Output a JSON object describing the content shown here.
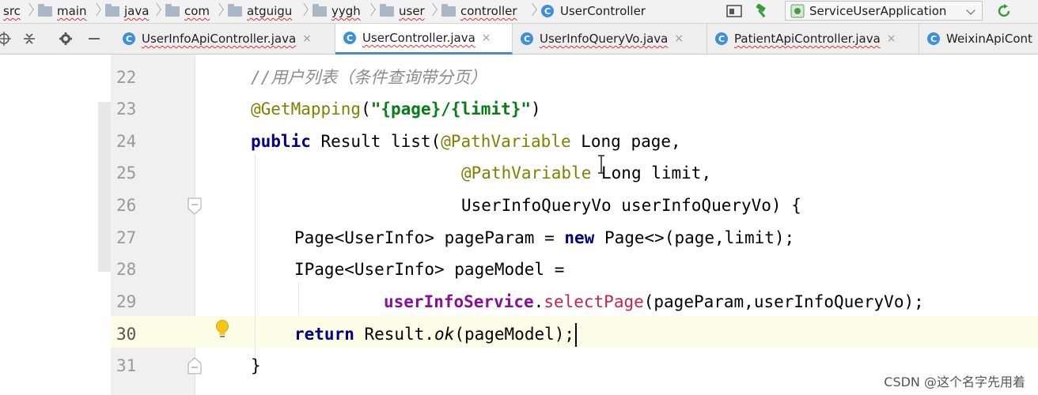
{
  "breadcrumb": {
    "items": [
      {
        "label": "src",
        "icon": "none"
      },
      {
        "label": "main",
        "icon": "folder-icon"
      },
      {
        "label": "java",
        "icon": "folder-icon"
      },
      {
        "label": "com",
        "icon": "folder-icon"
      },
      {
        "label": "atguigu",
        "icon": "folder-icon"
      },
      {
        "label": "yygh",
        "icon": "folder-icon"
      },
      {
        "label": "user",
        "icon": "folder-icon"
      },
      {
        "label": "controller",
        "icon": "folder-icon"
      },
      {
        "label": "UserController",
        "icon": "class-icon"
      }
    ]
  },
  "toolbar": {
    "run_config_label": "ServiceUserApplication",
    "icons": [
      "layout-icon",
      "build-hammer-icon",
      "run-config-app-icon",
      "reload-icon"
    ]
  },
  "tabs": [
    {
      "label": "UserInfoApiController.java",
      "icon": "class-icon",
      "active": false
    },
    {
      "label": "UserController.java",
      "icon": "class-icon",
      "active": true
    },
    {
      "label": "UserInfoQueryVo.java",
      "icon": "class-icon",
      "active": false
    },
    {
      "label": "PatientApiController.java",
      "icon": "class-icon",
      "active": false
    },
    {
      "label": "WeixinApiCont",
      "icon": "class-icon",
      "active": false
    }
  ],
  "tab_close_glyph": "×",
  "class_icon_glyph": "C",
  "editor": {
    "current_line": "30",
    "line_numbers": [
      "22",
      "23",
      "24",
      "25",
      "26",
      "27",
      "28",
      "29",
      "30",
      "31"
    ],
    "code": {
      "l22": {
        "comment": "//用户列表（条件查询带分页）"
      },
      "l23": {
        "annotation": "@GetMapping",
        "open": "(",
        "string": "\"{page}/{limit}\"",
        "close": ")"
      },
      "l24": {
        "kw": "public",
        "rest": " Result list(",
        "annotation": "@PathVariable",
        "tail": " Long page,"
      },
      "l25": {
        "annotation": "@PathVariable",
        "tail": " Long limit,"
      },
      "l26": {
        "text": "UserInfoQueryVo userInfoQueryVo) {"
      },
      "l27": {
        "pre": "Page<UserInfo> pageParam = ",
        "kw": "new",
        "post": " Page<>(page,limit);"
      },
      "l28": {
        "text": "IPage<UserInfo> pageModel ="
      },
      "l29": {
        "field": "userInfoService",
        "dot": ".",
        "method": "selectPage",
        "tail": "(pageParam,userInfoQueryVo);"
      },
      "l30": {
        "kw": "return",
        "pre": " Result.",
        "ital": "ok",
        "post": "(pageModel);"
      },
      "l31": {
        "text": "}"
      }
    }
  },
  "watermark": "CSDN @这个名字先用着",
  "colors": {
    "accent": "#4a88c7",
    "annotation": "#808000",
    "keyword": "#000080",
    "string": "#067d17",
    "field": "#871094",
    "method_call": "#c7254e",
    "comment": "#8c8c8c"
  }
}
